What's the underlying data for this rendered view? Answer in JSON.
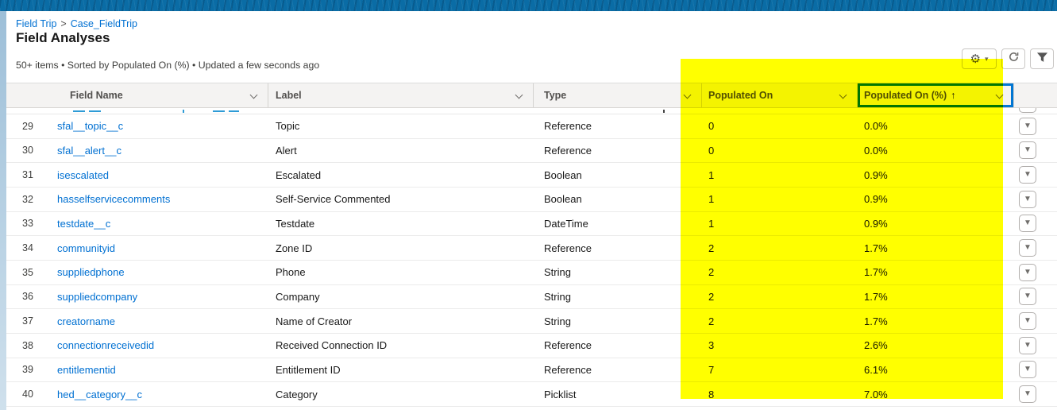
{
  "breadcrumb": {
    "items": [
      "Field Trip",
      "Case_FieldTrip"
    ],
    "separator": ">"
  },
  "header": {
    "title": "Field Analyses",
    "status": "50+ items • Sorted by Populated On (%) • Updated a few seconds ago"
  },
  "toolbar": {
    "buttons": [
      {
        "icon": "gear",
        "has_caret": true
      },
      {
        "icon": "refresh"
      },
      {
        "icon": "filter"
      }
    ]
  },
  "table": {
    "columns": [
      {
        "id": "field",
        "label": "Field Name"
      },
      {
        "id": "label",
        "label": "Label"
      },
      {
        "id": "type",
        "label": "Type"
      },
      {
        "id": "populated",
        "label": "Populated On",
        "highlighted": true
      },
      {
        "id": "pct",
        "label": "Populated On (%)",
        "highlighted": true,
        "sorted": true,
        "sort_indicator": "↑"
      }
    ],
    "rows": [
      {
        "num": "29",
        "field": "sfal__topic__c",
        "label": "Topic",
        "type": "Reference",
        "populated": "0",
        "pct": "0.0%"
      },
      {
        "num": "30",
        "field": "sfal__alert__c",
        "label": "Alert",
        "type": "Reference",
        "populated": "0",
        "pct": "0.0%"
      },
      {
        "num": "31",
        "field": "isescalated",
        "label": "Escalated",
        "type": "Boolean",
        "populated": "1",
        "pct": "0.9%"
      },
      {
        "num": "32",
        "field": "hasselfservicecomments",
        "label": "Self-Service Commented",
        "type": "Boolean",
        "populated": "1",
        "pct": "0.9%"
      },
      {
        "num": "33",
        "field": "testdate__c",
        "label": "Testdate",
        "type": "DateTime",
        "populated": "1",
        "pct": "0.9%"
      },
      {
        "num": "34",
        "field": "communityid",
        "label": "Zone ID",
        "type": "Reference",
        "populated": "2",
        "pct": "1.7%"
      },
      {
        "num": "35",
        "field": "suppliedphone",
        "label": "Phone",
        "type": "String",
        "populated": "2",
        "pct": "1.7%"
      },
      {
        "num": "36",
        "field": "suppliedcompany",
        "label": "Company",
        "type": "String",
        "populated": "2",
        "pct": "1.7%"
      },
      {
        "num": "37",
        "field": "creatorname",
        "label": "Name of Creator",
        "type": "String",
        "populated": "2",
        "pct": "1.7%"
      },
      {
        "num": "38",
        "field": "connectionreceivedid",
        "label": "Received Connection ID",
        "type": "Reference",
        "populated": "3",
        "pct": "2.6%"
      },
      {
        "num": "39",
        "field": "entitlementid",
        "label": "Entitlement ID",
        "type": "Reference",
        "populated": "7",
        "pct": "6.1%"
      },
      {
        "num": "40",
        "field": "hed__category__c",
        "label": "Category",
        "type": "Picklist",
        "populated": "8",
        "pct": "7.0%"
      }
    ]
  },
  "colors": {
    "topbar": "#0a6ca5",
    "link": "#0070d2",
    "highlight": "#ffff00",
    "sorted_column_focus_border": "#0176d3",
    "header_bg": "#f4f3f2"
  }
}
